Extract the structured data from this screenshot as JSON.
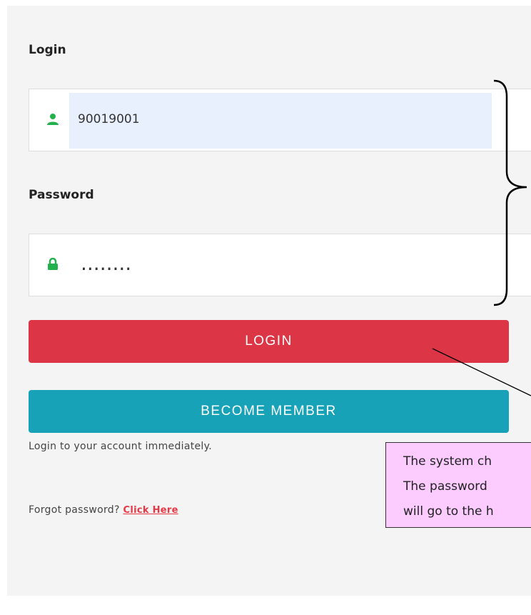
{
  "login_form": {
    "login_label": "Login",
    "username_value": "90019001",
    "password_label": "Password",
    "password_value": "........",
    "login_button": "LOGIN",
    "member_button": "BECOME MEMBER",
    "helper_text": "Login to your account immediately.",
    "forgot_text": "Forgot password?",
    "forgot_link": "Click Here"
  },
  "icons": {
    "username_icon": "user-icon",
    "password_icon": "lock-icon"
  },
  "colors": {
    "login_button": "#dc3545",
    "member_button": "#17a2b8",
    "icon_green": "#22b14c",
    "callout_bg": "#fccbff",
    "autofill_bg": "#e8f0fe"
  },
  "annotation": {
    "lines": [
      "The system ch",
      "The password",
      "will go to the h"
    ]
  }
}
